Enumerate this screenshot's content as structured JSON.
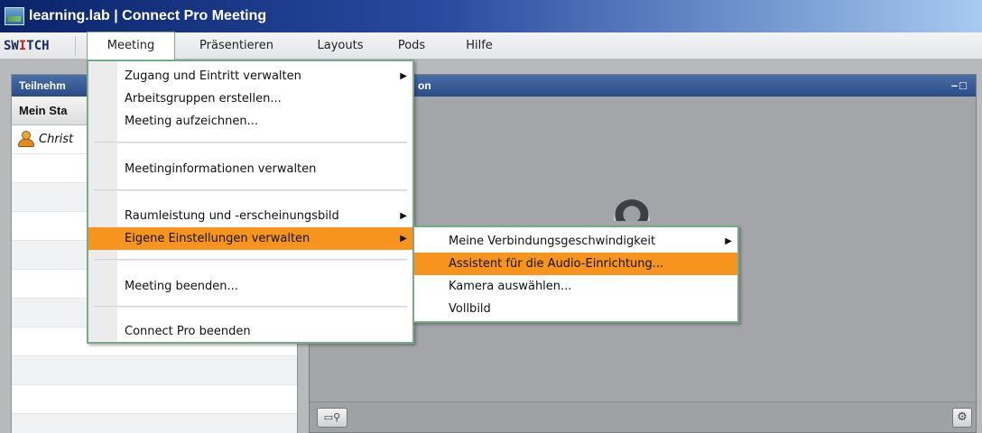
{
  "window": {
    "title": "learning.lab | Connect Pro Meeting"
  },
  "menubar": {
    "brand": {
      "main": "SW",
      "accent": "I",
      "rest": "TCH"
    },
    "items": [
      {
        "label": "Meeting"
      },
      {
        "label": "Präsentieren"
      },
      {
        "label": "Layouts"
      },
      {
        "label": "Pods"
      },
      {
        "label": "Hilfe"
      }
    ]
  },
  "left_pod": {
    "title": "Teilnehm",
    "subheader": "Mein Sta",
    "participant": "Christ"
  },
  "right_pod": {
    "title": "on",
    "window_controls": "–□"
  },
  "meeting_menu": {
    "items": [
      {
        "label": "Zugang und Eintritt verwalten",
        "arrow": "▶"
      },
      {
        "label": "Arbeitsgruppen erstellen..."
      },
      {
        "label": "Meeting aufzeichnen..."
      },
      {
        "label": "Meetinginformationen verwalten"
      },
      {
        "label": "Raumleistung und -erscheinungsbild",
        "arrow": "▶"
      },
      {
        "label": "Eigene Einstellungen verwalten",
        "arrow": "▶",
        "highlighted": true
      },
      {
        "label": "Meeting beenden..."
      },
      {
        "label": "Connect Pro beenden"
      }
    ]
  },
  "settings_submenu": {
    "items": [
      {
        "label": "Meine Verbindungsgeschwindigkeit",
        "arrow": "▶"
      },
      {
        "label": "Assistent für die Audio-Einrichtung...",
        "highlighted": true
      },
      {
        "label": "Kamera auswählen..."
      },
      {
        "label": "Vollbild"
      }
    ]
  },
  "icons": {
    "app": "connect-pro-app-icon",
    "participant": "user-presenter-icon",
    "camera": "webcam-icon",
    "av": "camera-microphone-icon",
    "settings": "gear-icon"
  },
  "colors": {
    "highlight": "#f7941d",
    "menu_border": "#7aa98a",
    "titlebar": "#0a246a",
    "pod_header": "#3a5e98"
  }
}
